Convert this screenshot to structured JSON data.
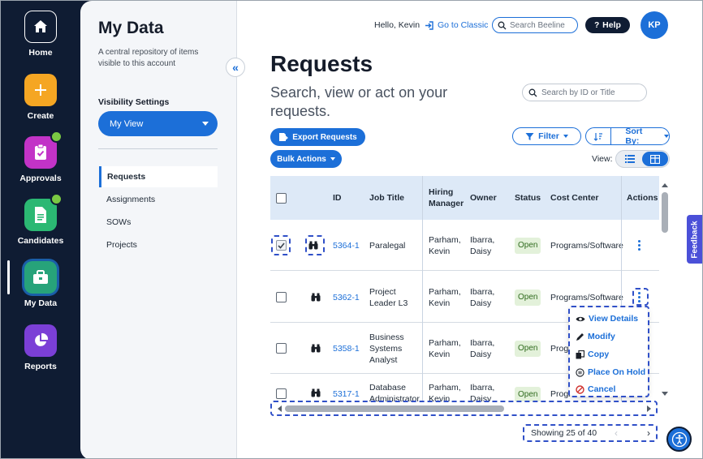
{
  "rail": {
    "items": [
      {
        "label": "Home",
        "icon": "home-icon"
      },
      {
        "label": "Create",
        "icon": "plus-icon"
      },
      {
        "label": "Approvals",
        "icon": "approval-icon"
      },
      {
        "label": "Candidates",
        "icon": "document-icon"
      },
      {
        "label": "My Data",
        "icon": "briefcase-icon"
      },
      {
        "label": "Reports",
        "icon": "pie-chart-icon"
      }
    ]
  },
  "panel": {
    "title": "My Data",
    "description": "A central repository of items visible to this account",
    "visibility_label": "Visibility Settings",
    "view_select": "My View",
    "nav": [
      "Requests",
      "Assignments",
      "SOWs",
      "Projects"
    ]
  },
  "header": {
    "greeting": "Hello, Kevin",
    "classic_link": "Go to Classic",
    "search_placeholder": "Search Beeline",
    "help_label": "Help",
    "avatar_initials": "KP"
  },
  "main": {
    "title": "Requests",
    "subtitle": "Search, view or act on your requests.",
    "search_placeholder": "Search by ID or Title",
    "export_label": "Export Requests",
    "bulk_label": "Bulk Actions",
    "filter_label": "Filter",
    "sort_label": "Sort By:",
    "view_label": "View:"
  },
  "table": {
    "headers": {
      "id": "ID",
      "job_title": "Job Title",
      "hiring_manager": "Hiring Manager",
      "owner": "Owner",
      "status": "Status",
      "cost_center": "Cost Center",
      "actions": "Actions"
    },
    "rows": [
      {
        "checked": true,
        "id": "5364-1",
        "job_title": "Paralegal",
        "hiring_manager": "Parham, Kevin",
        "owner": "Ibarra, Daisy",
        "status": "Open",
        "cost_center": "Programs/Software"
      },
      {
        "checked": false,
        "id": "5362-1",
        "job_title": "Project Leader L3",
        "hiring_manager": "Parham, Kevin",
        "owner": "Ibarra, Daisy",
        "status": "Open",
        "cost_center": "Programs/Software"
      },
      {
        "checked": false,
        "id": "5358-1",
        "job_title": "Business Systems Analyst",
        "hiring_manager": "Parham, Kevin",
        "owner": "Ibarra, Daisy",
        "status": "Open",
        "cost_center": "Progr"
      },
      {
        "checked": false,
        "id": "5317-1",
        "job_title": "Database Administrator",
        "hiring_manager": "Parham, Kevin",
        "owner": "Ibarra, Daisy",
        "status": "Open",
        "cost_center": "Progr"
      }
    ]
  },
  "action_menu": [
    "View Details",
    "Modify",
    "Copy",
    "Place On Hold",
    "Cancel"
  ],
  "footer": {
    "showing": "Showing 25 of 40"
  },
  "feedback_label": "Feedback",
  "colors": {
    "accent": "#1c6fd8",
    "rail": "#0f1c33",
    "create_tile": "#f5a623",
    "approvals_tile": "#c233c7",
    "candidates_tile": "#2bb873",
    "mydata_tile": "#27a37a",
    "reports_tile": "#7b3fd6",
    "status_open_bg": "#e3f1da",
    "annotation_dash": "#3050c8"
  }
}
